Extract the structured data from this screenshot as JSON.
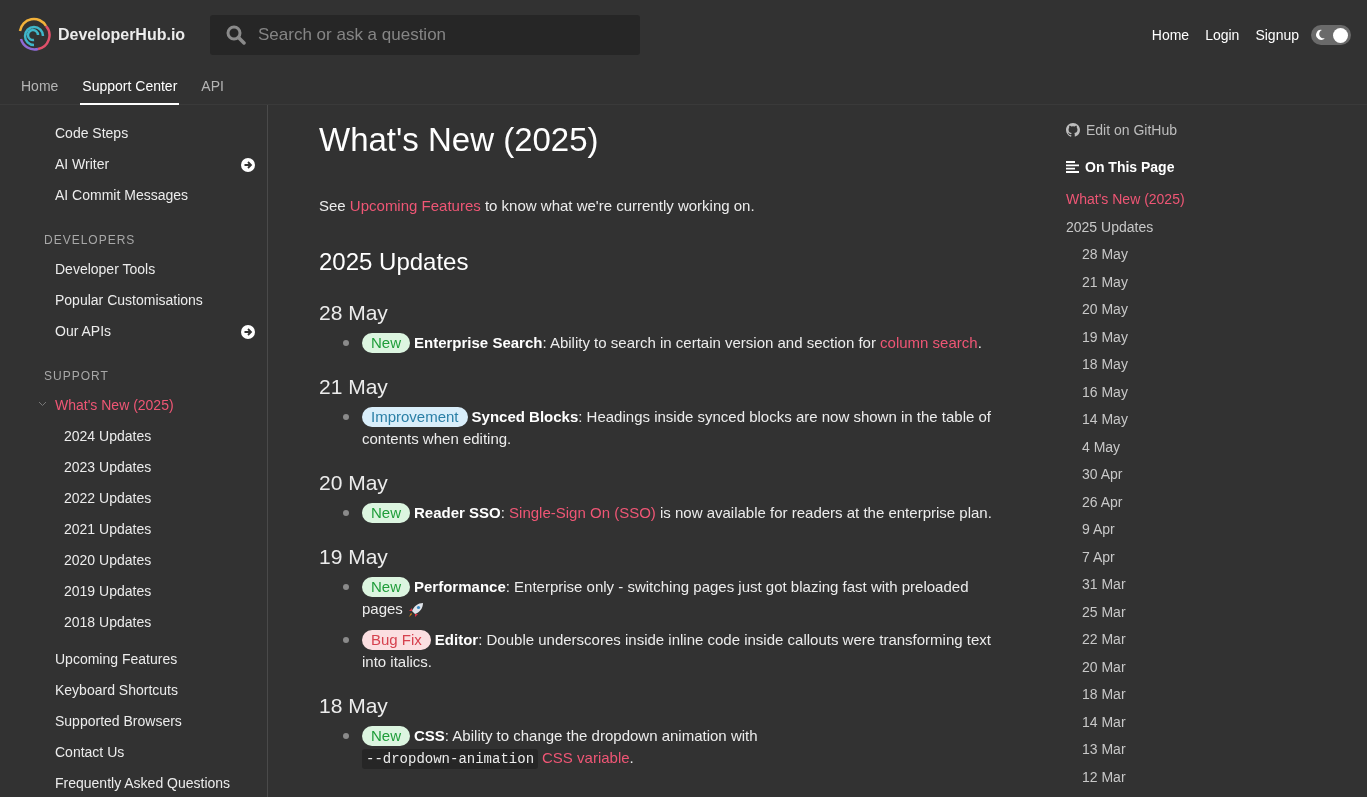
{
  "header": {
    "logo_text": "DeveloperHub.io",
    "search": {
      "placeholder": "Search or ask a question"
    },
    "nav": [
      "Home",
      "Login",
      "Signup"
    ],
    "theme_toggle": {
      "on": true
    }
  },
  "tabs": [
    {
      "label": "Home",
      "selected": false
    },
    {
      "label": "Support Center",
      "selected": true
    },
    {
      "label": "API",
      "selected": false
    }
  ],
  "sidebar": {
    "sections": [
      {
        "items": [
          {
            "label": "Code Steps",
            "selected": false,
            "link_icon": false
          },
          {
            "label": "AI Writer",
            "selected": false,
            "link_icon": true
          },
          {
            "label": "AI Commit Messages",
            "selected": false,
            "link_icon": false
          }
        ]
      },
      {
        "heading": "DEVELOPERS",
        "items": [
          {
            "label": "Developer Tools",
            "selected": false,
            "link_icon": false
          },
          {
            "label": "Popular Customisations",
            "selected": false,
            "link_icon": false
          },
          {
            "label": "Our APIs",
            "selected": false,
            "link_icon": true
          }
        ]
      },
      {
        "heading": "SUPPORT",
        "items": [
          {
            "label": "What's New (2025)",
            "selected": true,
            "link_icon": false,
            "expanded": true,
            "children": [
              {
                "label": "2024 Updates",
                "selected": false
              },
              {
                "label": "2023 Updates",
                "selected": false
              },
              {
                "label": "2022 Updates",
                "selected": false
              },
              {
                "label": "2021 Updates",
                "selected": false
              },
              {
                "label": "2020 Updates",
                "selected": false
              },
              {
                "label": "2019 Updates",
                "selected": false
              },
              {
                "label": "2018 Updates",
                "selected": false
              }
            ]
          },
          {
            "label": "Upcoming Features",
            "selected": false,
            "link_icon": false
          },
          {
            "label": "Keyboard Shortcuts",
            "selected": false,
            "link_icon": false
          },
          {
            "label": "Supported Browsers",
            "selected": false,
            "link_icon": false
          },
          {
            "label": "Contact Us",
            "selected": false,
            "link_icon": false
          },
          {
            "label": "Frequently Asked Questions",
            "selected": false,
            "link_icon": false
          }
        ]
      }
    ]
  },
  "main": {
    "title": "What's New (2025)",
    "intro": [
      {
        "kind": "text",
        "text": "See "
      },
      {
        "kind": "link",
        "text": "Upcoming Features"
      },
      {
        "kind": "text",
        "text": " to know what we're currently working on."
      }
    ],
    "section_title": "2025 Updates",
    "days": [
      {
        "date": "28 May",
        "entries": [
          {
            "badge": {
              "label": "New",
              "kind": "new"
            },
            "title": "Enterprise Search",
            "parts": [
              {
                "kind": "text",
                "text": ": Ability to search in certain version and section for "
              },
              {
                "kind": "link",
                "text": "column search"
              },
              {
                "kind": "text",
                "text": "."
              }
            ]
          }
        ]
      },
      {
        "date": "21 May",
        "entries": [
          {
            "badge": {
              "label": "Improvement",
              "kind": "improvement"
            },
            "title": "Synced Blocks",
            "parts": [
              {
                "kind": "text",
                "text": ": Headings inside synced blocks are now shown in the table of contents when editing."
              }
            ]
          }
        ]
      },
      {
        "date": "20 May",
        "entries": [
          {
            "badge": {
              "label": "New",
              "kind": "new"
            },
            "title": "Reader SSO",
            "parts": [
              {
                "kind": "text",
                "text": ": "
              },
              {
                "kind": "link",
                "text": "Single-Sign On (SSO)"
              },
              {
                "kind": "text",
                "text": " is now available for readers at the enterprise plan."
              }
            ]
          }
        ]
      },
      {
        "date": "19 May",
        "entries": [
          {
            "badge": {
              "label": "New",
              "kind": "new"
            },
            "title": "Performance",
            "parts": [
              {
                "kind": "text",
                "text": ": Enterprise only - switching pages just got blazing fast with preloaded pages"
              },
              {
                "kind": "rocket"
              }
            ]
          },
          {
            "badge": {
              "label": "Bug Fix",
              "kind": "bugfix"
            },
            "title": "Editor",
            "parts": [
              {
                "kind": "text",
                "text": ": Double underscores inside inline code inside callouts were transforming text into italics."
              }
            ]
          }
        ]
      },
      {
        "date": "18 May",
        "entries": [
          {
            "badge": {
              "label": "New",
              "kind": "new"
            },
            "title": "CSS",
            "parts": [
              {
                "kind": "text",
                "text": ": Ability to change the dropdown animation with "
              },
              {
                "kind": "code",
                "text": "--dropdown-animation"
              },
              {
                "kind": "link",
                "text": "CSS variable"
              },
              {
                "kind": "text",
                "text": "."
              }
            ]
          }
        ]
      }
    ]
  },
  "toc": {
    "edit_link": "Edit on GitHub",
    "heading": "On This Page",
    "items": [
      {
        "label": "What's New (2025)",
        "selected": true
      },
      {
        "label": "2025 Updates",
        "selected": false,
        "children": [
          {
            "label": "28 May",
            "selected": false
          },
          {
            "label": "21 May",
            "selected": false
          },
          {
            "label": "20 May",
            "selected": false
          },
          {
            "label": "19 May",
            "selected": false
          },
          {
            "label": "18 May",
            "selected": false
          },
          {
            "label": "16 May",
            "selected": false
          },
          {
            "label": "14 May",
            "selected": false
          },
          {
            "label": "4 May",
            "selected": false
          },
          {
            "label": "30 Apr",
            "selected": false
          },
          {
            "label": "26 Apr",
            "selected": false
          },
          {
            "label": "9 Apr",
            "selected": false
          },
          {
            "label": "7 Apr",
            "selected": false
          },
          {
            "label": "31 Mar",
            "selected": false
          },
          {
            "label": "25 Mar",
            "selected": false
          },
          {
            "label": "22 Mar",
            "selected": false
          },
          {
            "label": "20 Mar",
            "selected": false
          },
          {
            "label": "18 Mar",
            "selected": false
          },
          {
            "label": "14 Mar",
            "selected": false
          },
          {
            "label": "13 Mar",
            "selected": false
          },
          {
            "label": "12 Mar",
            "selected": false
          }
        ]
      }
    ]
  }
}
